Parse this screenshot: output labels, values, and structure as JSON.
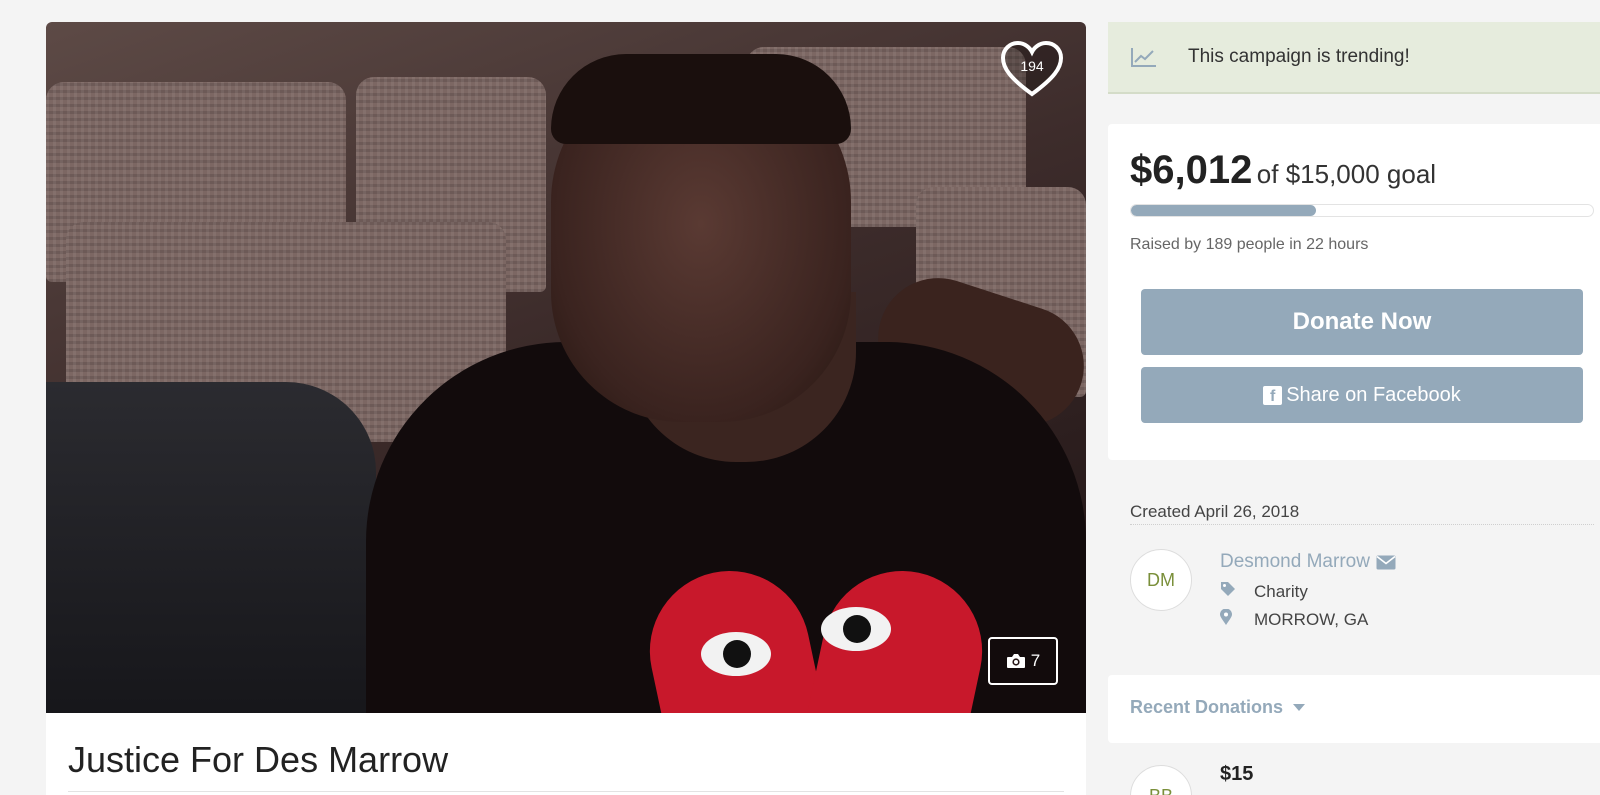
{
  "campaign": {
    "title": "Justice For Des Marrow",
    "likes": "194",
    "photo_count": "7"
  },
  "trending": {
    "icon": "trending-chart-icon",
    "text": "This campaign is trending!"
  },
  "goal": {
    "raised": "$6,012",
    "goal_text": "of $15,000 goal",
    "progress_fraction": 0.4,
    "raised_by": "Raised by 189 people in 22 hours"
  },
  "buttons": {
    "donate": "Donate Now",
    "share": "Share on Facebook"
  },
  "created": "Created April 26, 2018",
  "organizer": {
    "initials": "DM",
    "name": "Desmond Marrow",
    "category": "Charity",
    "location": "MORROW, GA"
  },
  "recent": {
    "label": "Recent Donations",
    "first_amount": "$15",
    "first_initials": "BB"
  },
  "colors": {
    "accent": "#94a9ba",
    "trending_bg": "#e6ecdd",
    "avatar_text": "#7a8f3a"
  }
}
